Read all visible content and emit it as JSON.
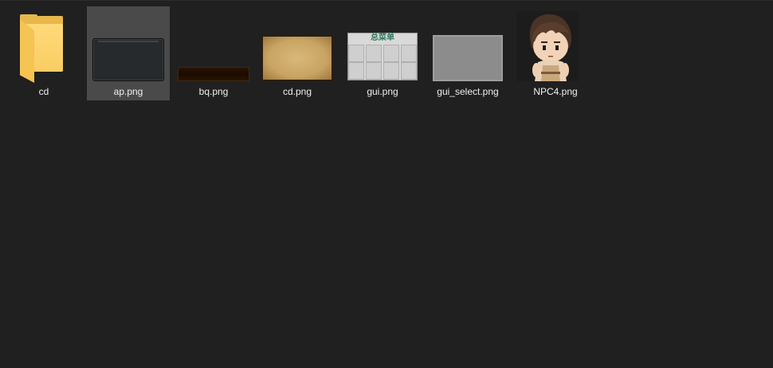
{
  "items": [
    {
      "name": "cd",
      "type": "folder",
      "icon": "folder-icon"
    },
    {
      "name": "ap.png",
      "type": "image",
      "icon": "image-thumbnail",
      "selected": true
    },
    {
      "name": "bq.png",
      "type": "image",
      "icon": "image-thumbnail"
    },
    {
      "name": "cd.png",
      "type": "image",
      "icon": "image-thumbnail"
    },
    {
      "name": "gui.png",
      "type": "image",
      "icon": "image-thumbnail",
      "thumb_text": "总菜单"
    },
    {
      "name": "gui_select.png",
      "type": "image",
      "icon": "image-thumbnail"
    },
    {
      "name": "NPC4.png",
      "type": "image",
      "icon": "character-thumbnail"
    }
  ],
  "colors": {
    "background": "#202020",
    "selected": "#4a4a4a",
    "folder": "#f9cd63",
    "label": "#f0f0f0"
  }
}
